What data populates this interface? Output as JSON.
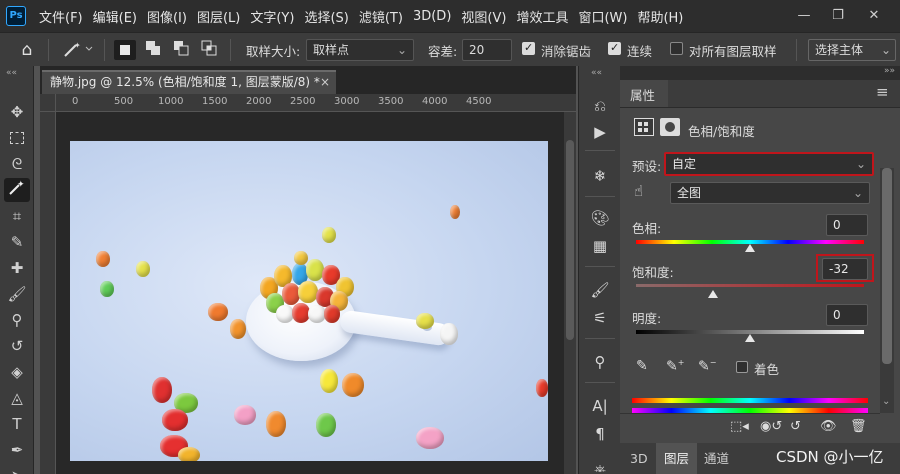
{
  "app": {
    "logo": "Ps"
  },
  "menu": [
    "文件(F)",
    "编辑(E)",
    "图像(I)",
    "图层(L)",
    "文字(Y)",
    "选择(S)",
    "滤镜(T)",
    "3D(D)",
    "视图(V)",
    "增效工具",
    "窗口(W)",
    "帮助(H)"
  ],
  "window_buttons": [
    "—",
    "❐",
    "✕"
  ],
  "options": {
    "sample_size_label": "取样大小:",
    "sample_size_value": "取样点",
    "tolerance_label": "容差:",
    "tolerance_value": "20",
    "anti_alias_label": "消除锯齿",
    "contiguous_label": "连续",
    "all_layers_label": "对所有图层取样",
    "select_subject_label": "选择主体"
  },
  "document": {
    "tab_title": "静物.jpg @ 12.5% (色相/饱和度 1, 图层蒙版/8) *",
    "close": "×"
  },
  "ruler": [
    "0",
    "500",
    "1000",
    "1500",
    "2000",
    "2500",
    "3000",
    "3500",
    "4000",
    "4500"
  ],
  "properties": {
    "tab_label": "属性",
    "adjust_title": "色相/饱和度",
    "preset_label": "预设:",
    "preset_value": "自定",
    "channel_value": "全图",
    "hue_label": "色相:",
    "hue_value": "0",
    "saturation_label": "饱和度:",
    "saturation_value": "-32",
    "lightness_label": "明度:",
    "lightness_value": "0",
    "colorize_label": "着色"
  },
  "bottom_tabs": [
    "3D",
    "图层",
    "通道"
  ],
  "watermark": "CSDN @小一亿",
  "colors": {
    "highlight": "#c0151b",
    "ps_blue": "#31a8ff"
  }
}
